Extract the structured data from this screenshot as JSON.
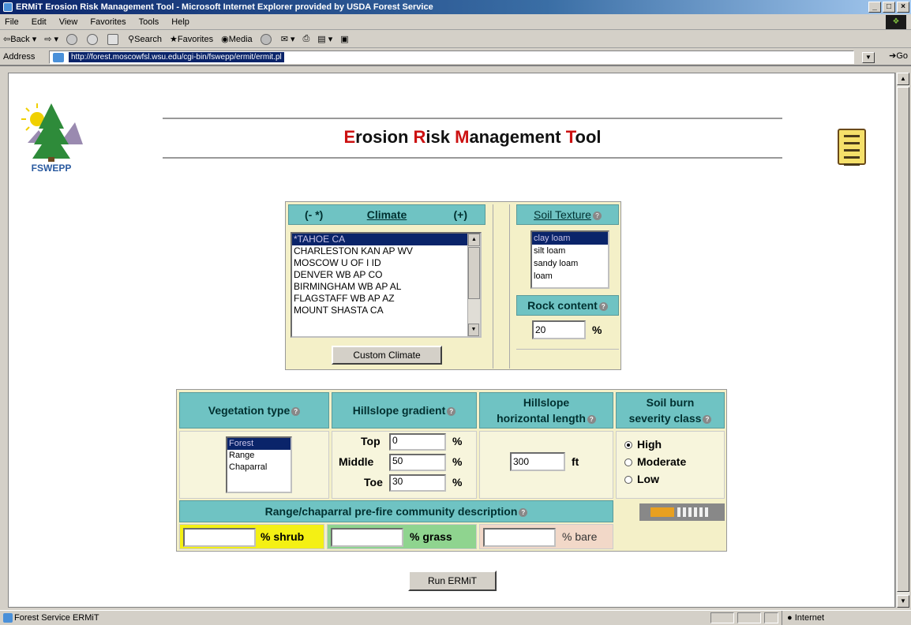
{
  "window": {
    "title": "ERMiT Erosion Risk Management Tool - Microsoft Internet Explorer provided by USDA Forest Service"
  },
  "menu": [
    "File",
    "Edit",
    "View",
    "Favorites",
    "Tools",
    "Help"
  ],
  "toolbar": {
    "back": "Back",
    "search": "Search",
    "favorites": "Favorites",
    "media": "Media"
  },
  "address": {
    "label": "Address",
    "url": "http://forest.moscowfsl.wsu.edu/cgi-bin/fswepp/ermit/ermit.pl",
    "go": "Go"
  },
  "page": {
    "logo_text": "FSWEPP",
    "title_parts": [
      {
        "text": "E",
        "red": true
      },
      {
        "text": "rosion ",
        "red": false
      },
      {
        "text": "R",
        "red": true
      },
      {
        "text": "isk ",
        "red": false
      },
      {
        "text": "M",
        "red": true
      },
      {
        "text": "anagement ",
        "red": false
      },
      {
        "text": "T",
        "red": true
      },
      {
        "text": "ool",
        "red": false
      }
    ],
    "climate": {
      "prev": "(- *)",
      "label": "Climate",
      "next": "(+)",
      "stations": [
        "*TAHOE CA",
        "CHARLESTON KAN AP WV",
        "MOSCOW U OF I ID",
        "DENVER WB AP CO",
        "BIRMINGHAM WB AP AL",
        "FLAGSTAFF WB AP AZ",
        "MOUNT SHASTA CA"
      ],
      "selected": "*TAHOE CA",
      "custom_button": "Custom Climate"
    },
    "soil": {
      "label": "Soil Texture",
      "options": [
        "clay loam",
        "silt loam",
        "sandy loam",
        "loam"
      ],
      "selected": "clay loam",
      "rock_label": "Rock content",
      "rock_value": "20",
      "rock_unit": "%"
    },
    "vegetation": {
      "label": "Vegetation type",
      "options": [
        "Forest",
        "Range",
        "Chaparral"
      ],
      "selected": "Forest"
    },
    "gradient": {
      "label": "Hillslope gradient",
      "top_label": "Top",
      "top_value": "0",
      "middle_label": "Middle",
      "middle_value": "50",
      "toe_label": "Toe",
      "toe_value": "30",
      "unit": "%"
    },
    "length": {
      "label_line1": "Hillslope",
      "label_line2": "horizontal length",
      "value": "300",
      "unit": "ft"
    },
    "severity": {
      "label_line1": "Soil burn",
      "label_line2": "severity class",
      "options": [
        "High",
        "Moderate",
        "Low"
      ],
      "selected": "High"
    },
    "community": {
      "label": "Range/chaparral pre-fire community description",
      "shrub_label": "% shrub",
      "grass_label": "% grass",
      "bare_label": "% bare",
      "shrub_color": "#f4f014",
      "grass_color": "#8fd48f",
      "bare_color": "#f2d8c8"
    },
    "run_button": "Run ERMiT"
  },
  "status": {
    "text": "Forest Service ERMiT",
    "zone": "Internet"
  }
}
